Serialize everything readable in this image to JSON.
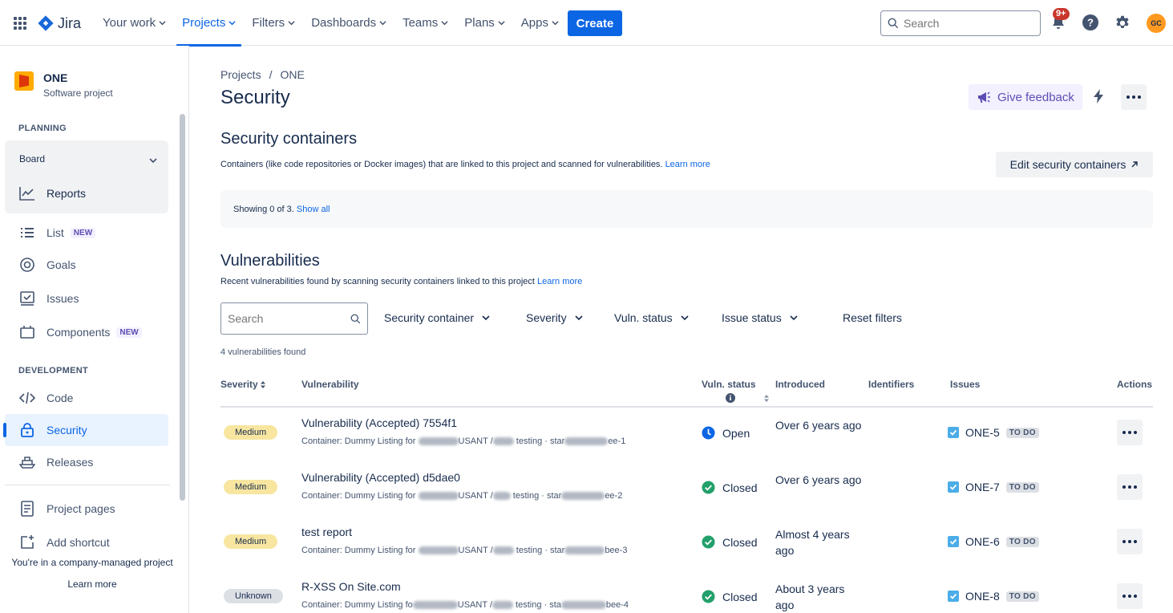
{
  "topnav": {
    "logo_text": "Jira",
    "items": [
      {
        "label": "Your work"
      },
      {
        "label": "Projects"
      },
      {
        "label": "Filters"
      },
      {
        "label": "Dashboards"
      },
      {
        "label": "Teams"
      },
      {
        "label": "Plans"
      },
      {
        "label": "Apps"
      }
    ],
    "create_label": "Create",
    "search_placeholder": "Search",
    "notifications_badge": "9+",
    "avatar_initials": "GC",
    "accent": "#0c66e4"
  },
  "sidebar": {
    "project_name": "ONE",
    "project_type": "Software project",
    "planning_label": "PLANNING",
    "board_label": "Board",
    "reports_label": "Reports",
    "list_label": "List",
    "list_tag": "NEW",
    "goals_label": "Goals",
    "issues_label": "Issues",
    "components_label": "Components",
    "components_tag": "NEW",
    "development_label": "DEVELOPMENT",
    "code_label": "Code",
    "security_label": "Security",
    "releases_label": "Releases",
    "project_pages_label": "Project pages",
    "add_shortcut_label": "Add shortcut",
    "footer_text": "You're in a company-managed project",
    "footer_link": "Learn more"
  },
  "main": {
    "breadcrumb_projects": "Projects",
    "breadcrumb_sep": "/",
    "breadcrumb_project": "ONE",
    "title": "Security",
    "feedback_label": "Give feedback",
    "containers": {
      "heading": "Security containers",
      "description": "Containers (like code repositories or Docker images) that are linked to this project and scanned for vulnerabilities.",
      "learn_more": "Learn more",
      "edit_label": "Edit security containers",
      "showing_text": "Showing 0 of 3.",
      "show_all": "Show all"
    },
    "vulns": {
      "heading": "Vulnerabilities",
      "description": "Recent vulnerabilities found by scanning security containers linked to this project",
      "learn_more": "Learn more",
      "search_placeholder": "Search",
      "filters": {
        "security_container": "Security container",
        "severity": "Severity",
        "vuln_status": "Vuln. status",
        "issue_status": "Issue status",
        "reset": "Reset filters"
      },
      "found_text": "4 vulnerabilities found",
      "columns": {
        "severity": "Severity",
        "vulnerability": "Vulnerability",
        "vuln_status": "Vuln. status",
        "introduced": "Introduced",
        "identifiers": "Identifiers",
        "issues": "Issues",
        "actions": "Actions"
      },
      "rows": [
        {
          "severity": "Medium",
          "name": "Vulnerability (Accepted) 7554f1",
          "container_a": "Container: Dummy Listing for",
          "container_b": "USANT /",
          "container_c": "testing · star",
          "container_d": "ee-1",
          "status": "Open",
          "introduced": "Over 6 years ago",
          "issue_key": "ONE-5",
          "issue_status": "TO DO"
        },
        {
          "severity": "Medium",
          "name": "Vulnerability (Accepted) d5dae0",
          "container_a": "Container: Dummy Listing for",
          "container_b": "USANT /",
          "container_c": "testing · star",
          "container_d": "ee-2",
          "status": "Closed",
          "introduced": "Over 6 years ago",
          "issue_key": "ONE-7",
          "issue_status": "TO DO"
        },
        {
          "severity": "Medium",
          "name": "test report",
          "container_a": "Container: Dummy Listing for",
          "container_b": "USANT /",
          "container_c": "testing · star",
          "container_d": "bee-3",
          "status": "Closed",
          "introduced": "Almost 4 years ago",
          "issue_key": "ONE-6",
          "issue_status": "TO DO"
        },
        {
          "severity": "Unknown",
          "name": "R-XSS On Site.com",
          "container_a": "Container: Dummy Listing fo",
          "container_b": "USANT /",
          "container_c": "testing · sta",
          "container_d": "bee-4",
          "status": "Closed",
          "introduced": "About 3 years ago",
          "issue_key": "ONE-8",
          "issue_status": "TO DO"
        }
      ]
    }
  },
  "colors": {
    "open": "#0c66e4",
    "closed": "#22a06b",
    "medium": "#f8e6a0",
    "unknown": "#dcdfe4"
  }
}
